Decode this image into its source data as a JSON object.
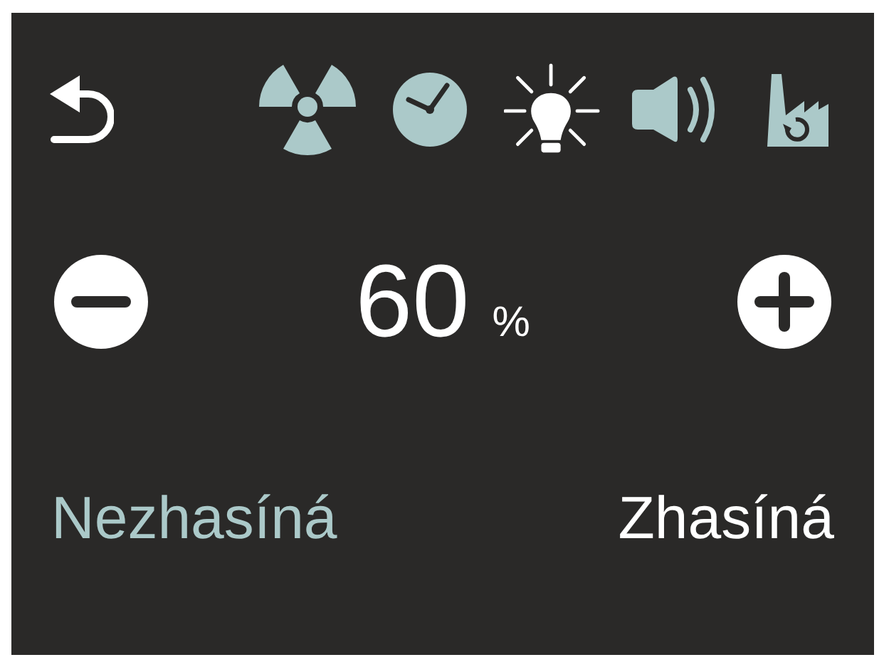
{
  "tabs": [
    {
      "selected": false
    },
    {
      "selected": false
    },
    {
      "selected": true
    },
    {
      "selected": false
    },
    {
      "selected": false
    }
  ],
  "value": "60",
  "unit": "%",
  "options": [
    {
      "label": "Nezhasíná",
      "selected": false
    },
    {
      "label": "Zhasíná",
      "selected": true
    }
  ]
}
